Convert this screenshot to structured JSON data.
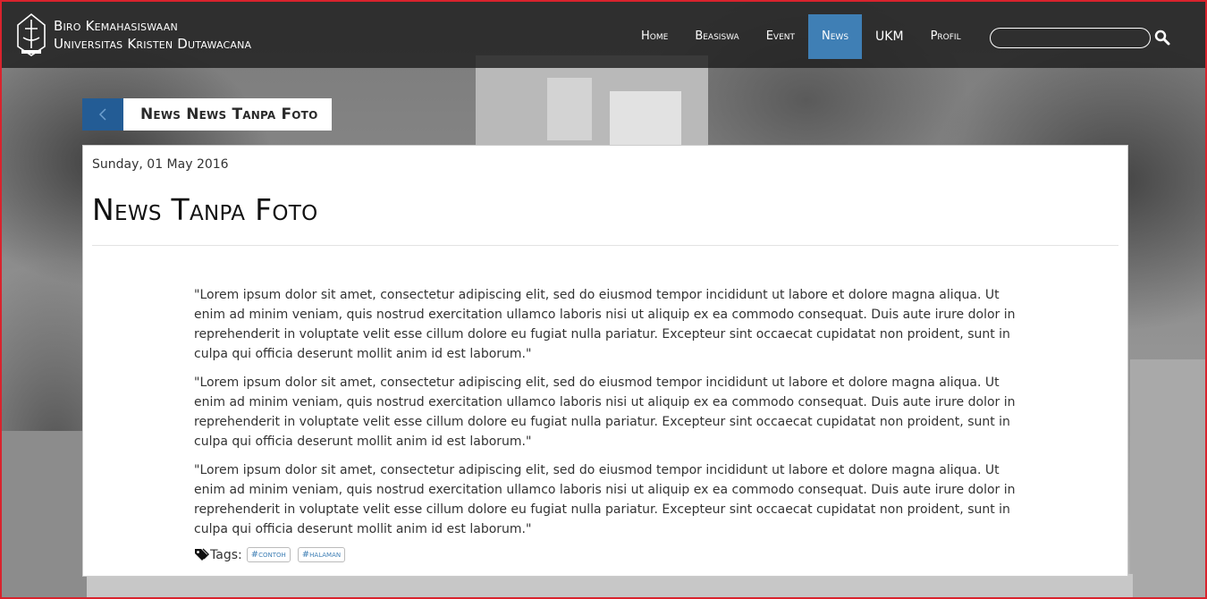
{
  "brand": {
    "line1": "Biro Kemahasiswaan",
    "line2": "Universitas Kristen Dutawacana"
  },
  "nav": {
    "items": [
      {
        "label": "Home"
      },
      {
        "label": "Beasiswa"
      },
      {
        "label": "Event"
      },
      {
        "label": "News",
        "active": true
      },
      {
        "label": "UKM"
      },
      {
        "label": "Profil"
      }
    ]
  },
  "search": {
    "placeholder": "",
    "value": ""
  },
  "breadcrumb": {
    "label": "News News Tanpa Foto"
  },
  "article": {
    "date": "Sunday, 01 May 2016",
    "title": "News Tanpa Foto",
    "paragraphs": [
      "\"Lorem ipsum dolor sit amet, consectetur adipiscing elit, sed do eiusmod tempor incididunt ut labore et dolore magna aliqua. Ut enim ad minim veniam, quis nostrud exercitation ullamco laboris nisi ut aliquip ex ea commodo consequat. Duis aute irure dolor in reprehenderit in voluptate velit esse cillum dolore eu fugiat nulla pariatur. Excepteur sint occaecat cupidatat non proident, sunt in culpa qui officia deserunt mollit anim id est laborum.\"",
      "\"Lorem ipsum dolor sit amet, consectetur adipiscing elit, sed do eiusmod tempor incididunt ut labore et dolore magna aliqua. Ut enim ad minim veniam, quis nostrud exercitation ullamco laboris nisi ut aliquip ex ea commodo consequat. Duis aute irure dolor in reprehenderit in voluptate velit esse cillum dolore eu fugiat nulla pariatur. Excepteur sint occaecat cupidatat non proident, sunt in culpa qui officia deserunt mollit anim id est laborum.\"",
      "\"Lorem ipsum dolor sit amet, consectetur adipiscing elit, sed do eiusmod tempor incididunt ut labore et dolore magna aliqua. Ut enim ad minim veniam, quis nostrud exercitation ullamco laboris nisi ut aliquip ex ea commodo consequat. Duis aute irure dolor in reprehenderit in voluptate velit esse cillum dolore eu fugiat nulla pariatur. Excepteur sint occaecat cupidatat non proident, sunt in culpa qui officia deserunt mollit anim id est laborum.\""
    ],
    "tags_label": "Tags:",
    "tags": [
      "#contoh",
      "#halaman"
    ]
  },
  "colors": {
    "accent": "#3f7fb5",
    "back_button": "#235c95",
    "navbar": "#1e1e1e"
  },
  "icons": {
    "logo": "university-seal-icon",
    "search": "search-icon",
    "back": "chevron-left-icon",
    "tags": "tags-icon"
  }
}
